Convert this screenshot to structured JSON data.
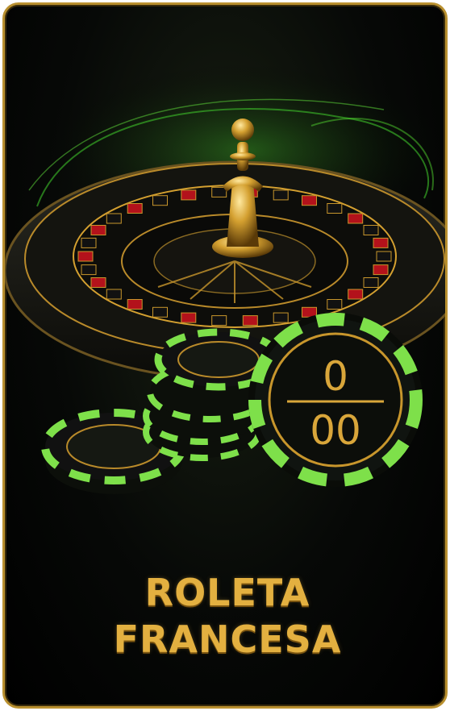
{
  "card": {
    "title_line1": "ROLETA",
    "title_line2": "FRANCESA"
  },
  "chip": {
    "top_label": "0",
    "bottom_label": "00"
  },
  "colors": {
    "gold": "#e3b040",
    "chip_green": "#7ee04a",
    "wheel_red": "#b3121b",
    "background": "#050705"
  },
  "icons": [
    "roulette-wheel-icon",
    "casino-chip-icon"
  ]
}
